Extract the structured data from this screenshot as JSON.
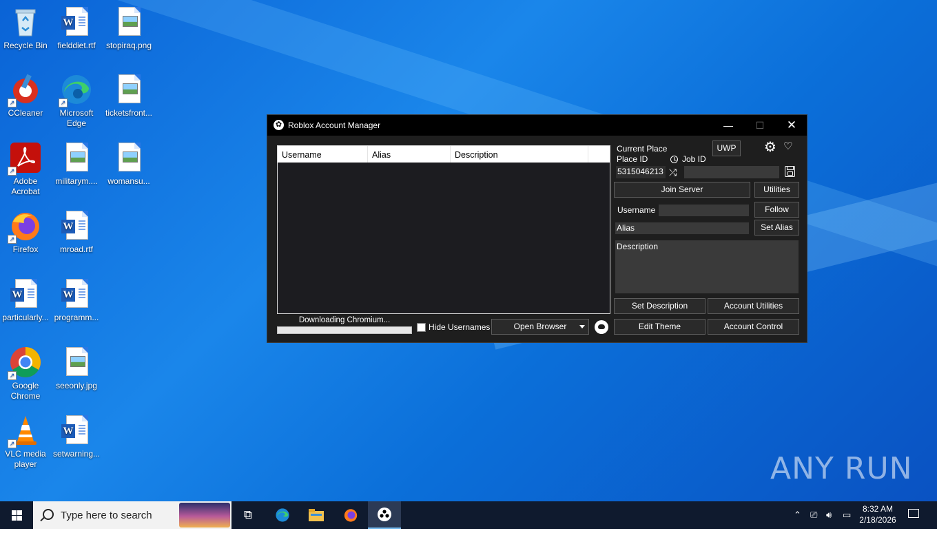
{
  "desktop": {
    "icons": [
      {
        "label": "Recycle Bin"
      },
      {
        "label": "fielddiet.rtf"
      },
      {
        "label": "stopiraq.png"
      },
      {
        "label": "CCleaner"
      },
      {
        "label": "Microsoft Edge"
      },
      {
        "label": "ticketsfront..."
      },
      {
        "label": "Adobe Acrobat"
      },
      {
        "label": "militarym...."
      },
      {
        "label": "womansu..."
      },
      {
        "label": "Firefox"
      },
      {
        "label": "mroad.rtf"
      },
      {
        "label": "particularly..."
      },
      {
        "label": "programm..."
      },
      {
        "label": "Google Chrome"
      },
      {
        "label": "seeonly.jpg"
      },
      {
        "label": "VLC media player"
      },
      {
        "label": "setwarning..."
      }
    ],
    "watermark": "ANY RUN"
  },
  "window": {
    "title": "Roblox Account Manager",
    "controls": {
      "minimize": "—",
      "maximize": "☐",
      "close": "✕"
    },
    "list_columns": [
      "Username",
      "Alias",
      "Description"
    ],
    "progress_label": "Downloading Chromium...",
    "progress_value": 0,
    "hide_usernames_label": "Hide Usernames",
    "hide_usernames_checked": false,
    "open_browser_label": "Open Browser",
    "current_place_label": "Current Place",
    "place_id_label": "Place ID",
    "job_id_label": "Job ID",
    "uwp_label": "UWP",
    "place_id_value": "5315046213",
    "job_id_value": "",
    "join_server_label": "Join Server",
    "utilities_label": "Utilities",
    "username_label": "Username",
    "username_value": "",
    "follow_label": "Follow",
    "alias_placeholder": "Alias",
    "set_alias_label": "Set Alias",
    "description_placeholder": "Description",
    "set_description_label": "Set Description",
    "account_utilities_label": "Account Utilities",
    "edit_theme_label": "Edit Theme",
    "account_control_label": "Account Control"
  },
  "taskbar": {
    "search_placeholder": "Type here to search",
    "time": "8:32 AM",
    "date": "2/18/2026"
  }
}
